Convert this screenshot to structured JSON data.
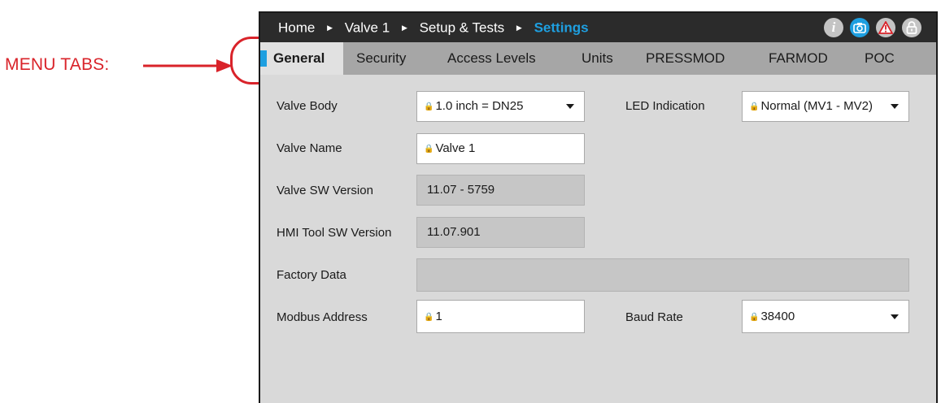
{
  "annotation": {
    "label": "MENU TABS:"
  },
  "breadcrumb": {
    "items": [
      "Home",
      "Valve 1",
      "Setup & Tests",
      "Settings"
    ],
    "separator": "▶"
  },
  "header_icons": [
    "info-icon",
    "camera-icon",
    "warning-icon",
    "lock-icon"
  ],
  "header_icon_glyphs": {
    "info": "i"
  },
  "tabs": [
    "General",
    "Security",
    "Access Levels",
    "Units",
    "PRESSMOD",
    "FARMOD",
    "POC"
  ],
  "active_tab": "General",
  "form": {
    "valve_body": {
      "label": "Valve Body",
      "value": "1.0 inch = DN25"
    },
    "led_indication": {
      "label": "LED Indication",
      "value": "Normal (MV1 - MV2)"
    },
    "valve_name": {
      "label": "Valve Name",
      "value": "Valve 1"
    },
    "valve_sw_version": {
      "label": "Valve SW Version",
      "value": "11.07 - 5759"
    },
    "hmi_sw_version": {
      "label": "HMI Tool SW Version",
      "value": "11.07.901"
    },
    "factory_data": {
      "label": "Factory Data",
      "value": ""
    },
    "modbus_address": {
      "label": "Modbus Address",
      "value": "1"
    },
    "baud_rate": {
      "label": "Baud Rate",
      "value": "38400"
    }
  },
  "colors": {
    "accent": "#1e9fe0",
    "annotation": "#d9232a",
    "titlebar": "#2b2b2b",
    "tabbar": "#a6a6a6",
    "panel": "#d9d9d9"
  }
}
